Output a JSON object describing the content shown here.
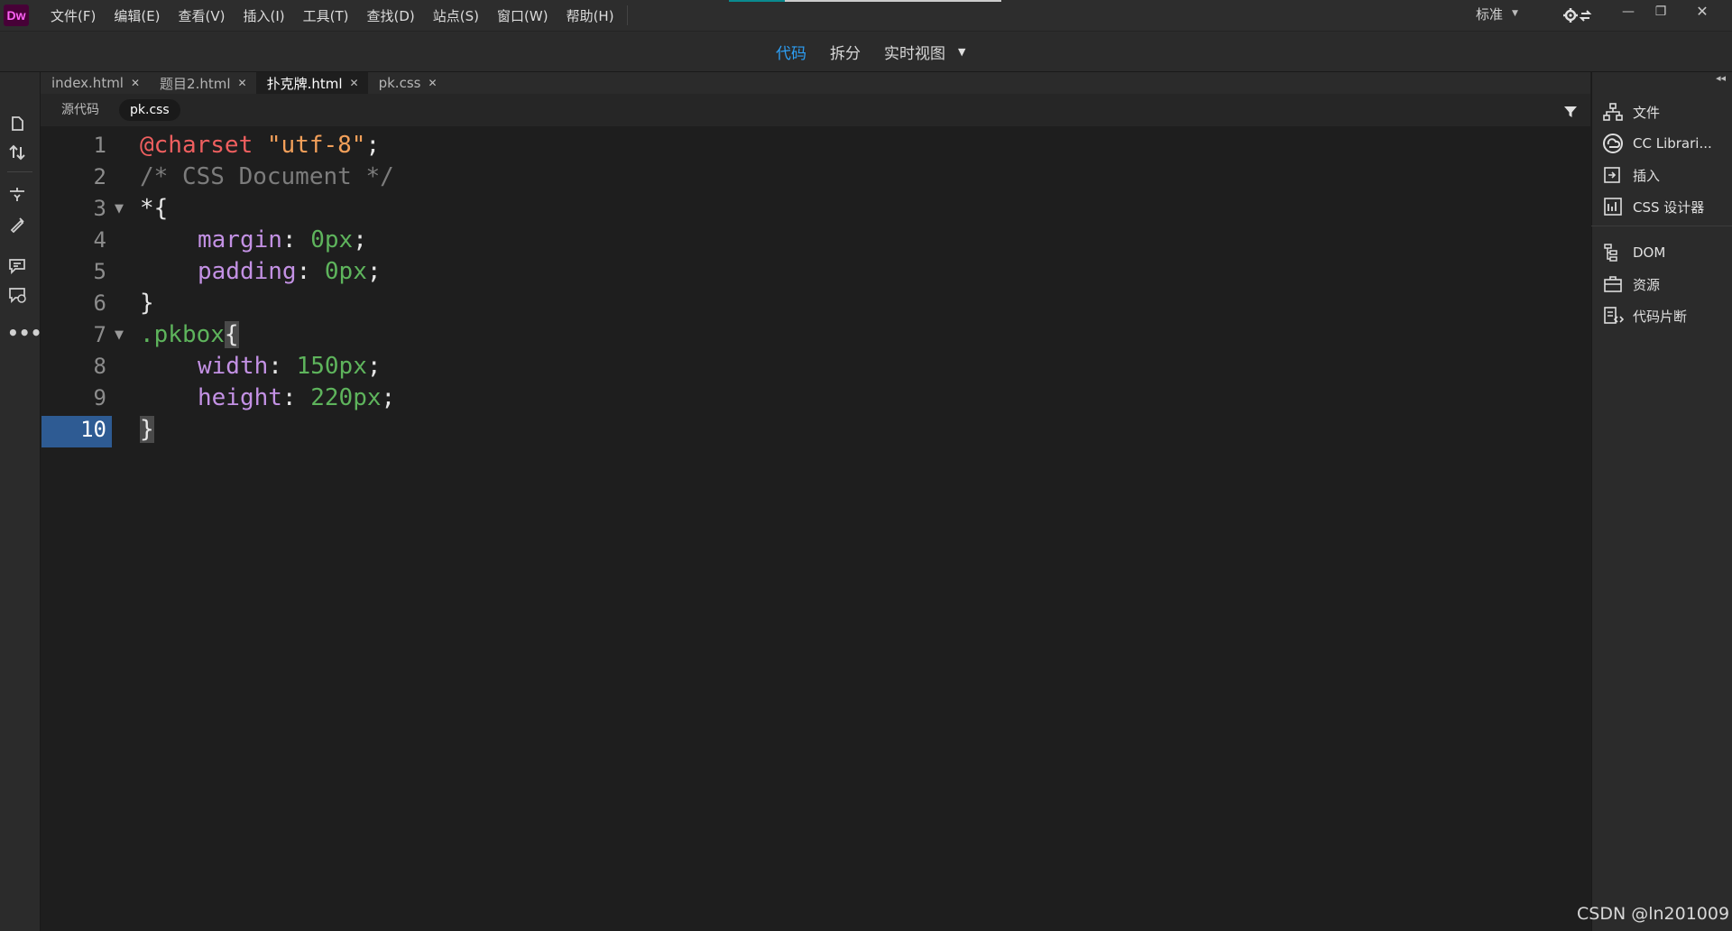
{
  "app": {
    "logo": "Dw"
  },
  "menu": [
    {
      "label": "文件(F)"
    },
    {
      "label": "编辑(E)"
    },
    {
      "label": "查看(V)"
    },
    {
      "label": "插入(I)"
    },
    {
      "label": "工具(T)"
    },
    {
      "label": "查找(D)"
    },
    {
      "label": "站点(S)"
    },
    {
      "label": "窗口(W)"
    },
    {
      "label": "帮助(H)"
    }
  ],
  "workspace": {
    "label": "标准"
  },
  "view_switch": {
    "code": "代码",
    "split": "拆分",
    "live": "实时视图",
    "active": "code"
  },
  "tabs": [
    {
      "label": "index.html",
      "active": false
    },
    {
      "label": "题目2.html",
      "active": false
    },
    {
      "label": "扑克牌.html",
      "active": true
    },
    {
      "label": "pk.css",
      "active": false
    }
  ],
  "related_files": {
    "source": "源代码",
    "current": "pk.css"
  },
  "editor": {
    "current_line": 10,
    "lines": [
      {
        "no": "1"
      },
      {
        "no": "2"
      },
      {
        "no": "3"
      },
      {
        "no": "4"
      },
      {
        "no": "5"
      },
      {
        "no": "6"
      },
      {
        "no": "7"
      },
      {
        "no": "8"
      },
      {
        "no": "9"
      },
      {
        "no": "10"
      }
    ],
    "tokens": {
      "l1_at": "@charset",
      "l1_str": "\"utf-8\"",
      "l1_end": ";",
      "l2_comment": "/* CSS Document */",
      "l3_sel": "*",
      "l3_brace": "{",
      "l4_prop": "margin",
      "l4_colon": ": ",
      "l4_val": "0px",
      "l4_end": ";",
      "l5_prop": "padding",
      "l5_colon": ": ",
      "l5_val": "0px",
      "l5_end": ";",
      "l6_brace": "}",
      "l7_sel": ".pkbox",
      "l7_brace": "{",
      "l8_prop": "width",
      "l8_colon": ": ",
      "l8_val": "150px",
      "l8_end": ";",
      "l9_prop": "height",
      "l9_colon": ": ",
      "l9_val": "220px",
      "l9_end": ";",
      "l10_brace": "}"
    }
  },
  "right_panel": [
    {
      "label": "文件",
      "icon": "files-icon"
    },
    {
      "label": "CC Librari...",
      "icon": "cc-libraries-icon"
    },
    {
      "label": "插入",
      "icon": "insert-icon"
    },
    {
      "label": "CSS 设计器",
      "icon": "css-designer-icon"
    },
    {
      "label": "DOM",
      "icon": "dom-icon"
    },
    {
      "label": "资源",
      "icon": "assets-icon"
    },
    {
      "label": "代码片断",
      "icon": "snippets-icon"
    }
  ],
  "watermark": "CSDN @ln201009",
  "colors": {
    "accent": "#2d9ff5",
    "current_line": "#2e5b93",
    "at_rule": "#ef5f5f",
    "string": "#f3a05a",
    "property": "#c391e4",
    "value": "#5eb45c",
    "comment": "#7c7c7c"
  }
}
